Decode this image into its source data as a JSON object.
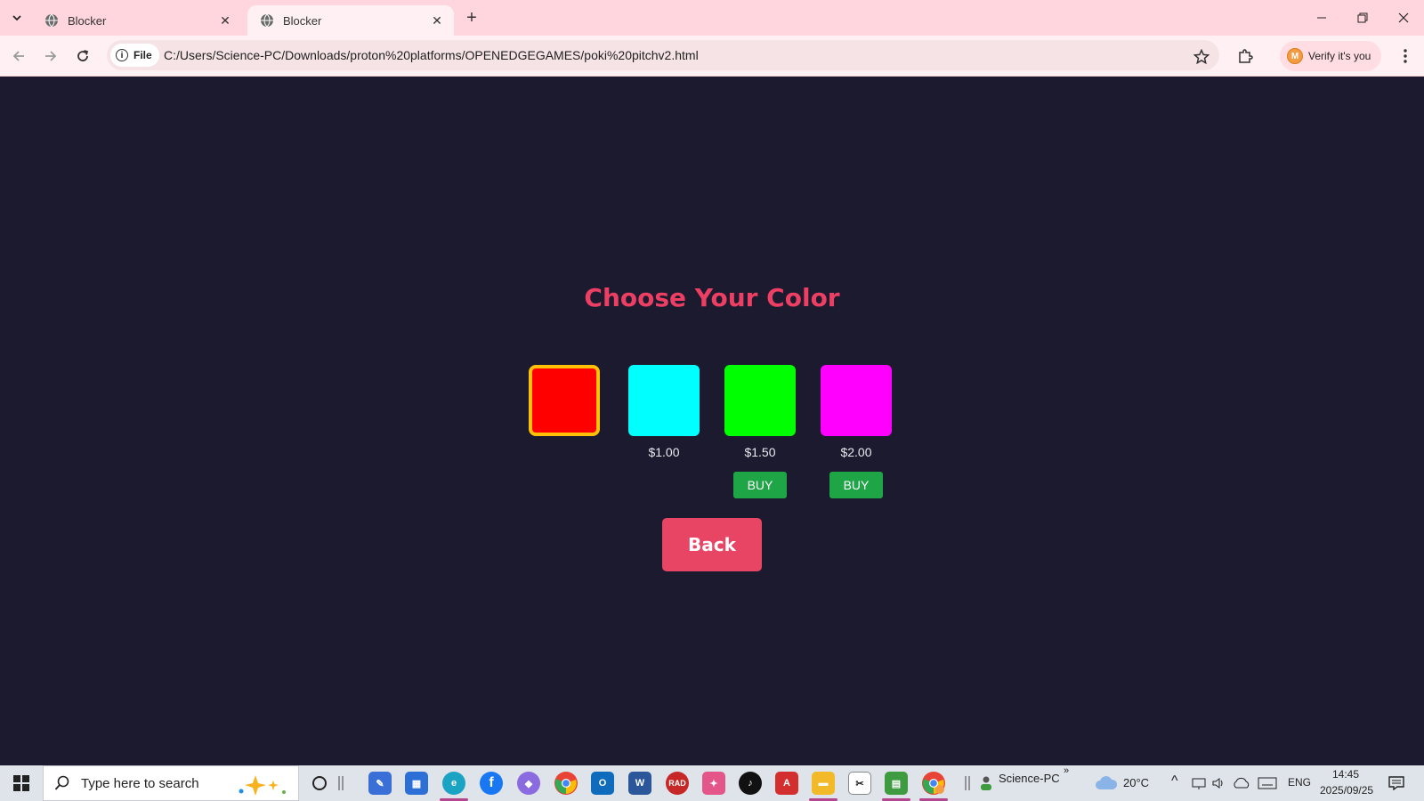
{
  "browser": {
    "tabs": [
      {
        "title": "Blocker",
        "active": false
      },
      {
        "title": "Blocker",
        "active": true
      }
    ],
    "chip_label": "File",
    "url": "C:/Users/Science-PC/Downloads/proton%20platforms/OPENEDGEGAMES/poki%20pitchv2.html",
    "profile_label": "Verify it's you",
    "profile_initial": "M"
  },
  "page": {
    "heading": "Choose Your Color",
    "colors": [
      {
        "name": "red",
        "hex": "#ff0000",
        "price": "",
        "selected": true,
        "buy": ""
      },
      {
        "name": "cyan",
        "hex": "#00ffff",
        "price": "$1.00",
        "selected": false,
        "buy": ""
      },
      {
        "name": "green",
        "hex": "#00ff00",
        "price": "$1.50",
        "selected": false,
        "buy": "BUY"
      },
      {
        "name": "magenta",
        "hex": "#ff00ff",
        "price": "$2.00",
        "selected": false,
        "buy": "BUY"
      }
    ],
    "back_label": "Back",
    "accent": "#ec3f63",
    "background": "#1b1a2e"
  },
  "taskbar": {
    "search_placeholder": "Type here to search",
    "user": "Science-PC",
    "weather": "20°C",
    "language": "ENG",
    "time": "14:45",
    "date": "2025/09/25",
    "apps": [
      "task-view-icon",
      "powerpoint-like-icon",
      "store-icon",
      "edge-icon",
      "facebook-icon",
      "copilot-icon",
      "chrome-icon",
      "outlook-icon",
      "word-icon",
      "rad-icon",
      "copilot-app-icon",
      "tiktok-icon",
      "acrobat-icon",
      "file-explorer-icon",
      "sniping-icon",
      "task-manager-icon",
      "chrome-profile-icon"
    ]
  }
}
